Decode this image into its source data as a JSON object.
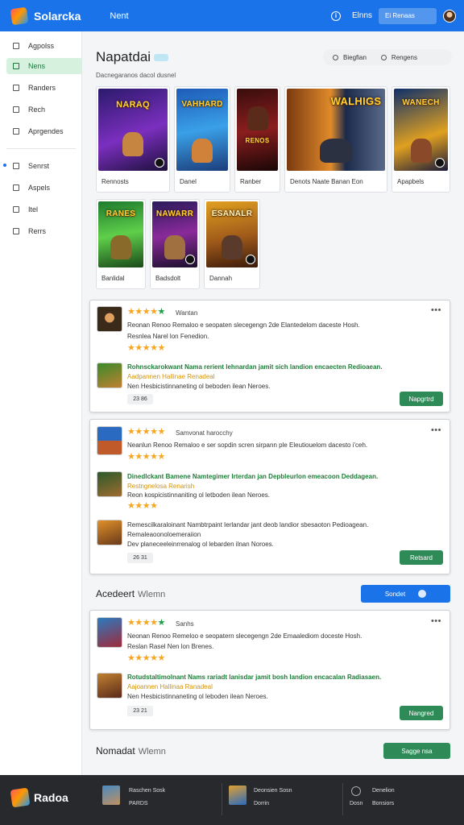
{
  "app": {
    "brand": "Solarcka",
    "nav_label": "Nent"
  },
  "topbar": {
    "info_icon": "i",
    "link": "Elnns",
    "search": "Ei Renaas"
  },
  "sidebar": {
    "items": [
      {
        "label": "Agpolss",
        "icon": "grid-icon"
      },
      {
        "label": "Nens",
        "icon": "home-icon",
        "active": true
      },
      {
        "label": "Randers",
        "icon": "list-icon"
      },
      {
        "label": "Rech",
        "icon": "bookmark-icon"
      },
      {
        "label": "Aprgendes",
        "icon": "folder-icon"
      },
      {
        "label": "Senrst",
        "icon": "star-icon",
        "dot": true
      },
      {
        "label": "Aspels",
        "icon": "doc-icon"
      },
      {
        "label": "Itel",
        "icon": "tag-icon"
      },
      {
        "label": "Rerrs",
        "icon": "flag-icon"
      }
    ]
  },
  "main": {
    "title": "Napatdai",
    "subtitle": "Dacnegaranos dacol dusnel",
    "tools": {
      "search_label": "Biegfian",
      "filter_label": "Rengens"
    },
    "games": [
      {
        "label": "Rennosts",
        "art": "NARAQ"
      },
      {
        "label": "Danel",
        "art": "VAHHARD"
      },
      {
        "label": "Ranber",
        "art": "RENOS"
      },
      {
        "label": "Denots Naate  Banan Eon",
        "art": "WALHIGS"
      },
      {
        "label": "Apapbels",
        "art": "WANECH"
      },
      {
        "label": "Banlidal",
        "art": "RANES"
      },
      {
        "label": "Badsdolt",
        "art": "NAWARR"
      },
      {
        "label": "Dannah",
        "art": "ESANALR"
      }
    ],
    "review_cards": [
      {
        "reviews": [
          {
            "name": "Wantan",
            "stars": 4,
            "has_green_star": true,
            "line1": "Reonan Renoo Remaloo e seopaten slecegengn 2de Elantedelom daceste Hosh.",
            "line2": "Resnlea Narel lon Fenedion."
          },
          {
            "stars": 5,
            "line1": "Rohnsckarokwant Nama rerient lehnardan jamit sich landion encaecten Redioaean.",
            "line2": "Aadpannen Hallinae Renadeal",
            "line3": "Nen Hesbicistinnaneting ol beboden ilean Neroes."
          }
        ],
        "meta": "23 86",
        "action": "Napgrtrd"
      },
      {
        "reviews": [
          {
            "name": "Samvonat harocchy",
            "stars": 5,
            "line1": "Neanlun Renoo Remaloo e ser sopdin scren sirpann ple Eleutiouelom dacesto i'ceh."
          },
          {
            "stars": 5,
            "line1": "Dinedlckant Bamene Namtegimer Irterdan jan Depbleurlon emeacoon Deddagean.",
            "line2": "Restngnelosa Renarish",
            "line3": "Reon kospicistinnaniting ol letboden ilean Neroes."
          },
          {
            "stars": 4,
            "line1": "Remescilkaraloinant Nambtrpaint Ierlandar jant deob landior sbesaoton Pedioagean.",
            "line2": "Remaleaoonoloemeraiion",
            "line3": "Dev planeceeleinrrenalog ol lebarden ilnan Noroes."
          }
        ],
        "meta": "26 31",
        "action": "Retsard"
      }
    ],
    "section1": {
      "title": "Acedeert",
      "sub": "Wlemn",
      "button": "Sondet"
    },
    "card3": {
      "reviews": [
        {
          "name": "Sanhs",
          "stars": 4,
          "has_green_star": true,
          "line1": "Neonan Renoo Remeloo e seopatern slecegengn 2de Emaalediom doceste Hosh.",
          "line2": "Reslan Rasel Nen lon Brenes."
        },
        {
          "stars": 5,
          "line1": "Rotudstaltimolnant Nams rariadt lanisdar jamit bosh landion encacalan Radiasaen.",
          "line2": "Aajoannen Hallinaa Ranadeal",
          "line3": "Nen Hesbicistinnaneting ol leboden ilean Neroes."
        }
      ],
      "meta": "23 21",
      "action": "Nangred"
    },
    "section2": {
      "title": "Nomadat",
      "sub": "Wlemn",
      "button": "Sagge  nsa"
    }
  },
  "footer": {
    "brand": "Radoa",
    "col1": {
      "line1": "Raschen Sosk",
      "line2": "PARDS"
    },
    "col2": {
      "line1": "Deonsien Sosn",
      "line2": "Dorrin"
    },
    "col3": {
      "line1": "Denelion",
      "line2a": "Dosn",
      "line2b": "Bonsiors"
    }
  }
}
